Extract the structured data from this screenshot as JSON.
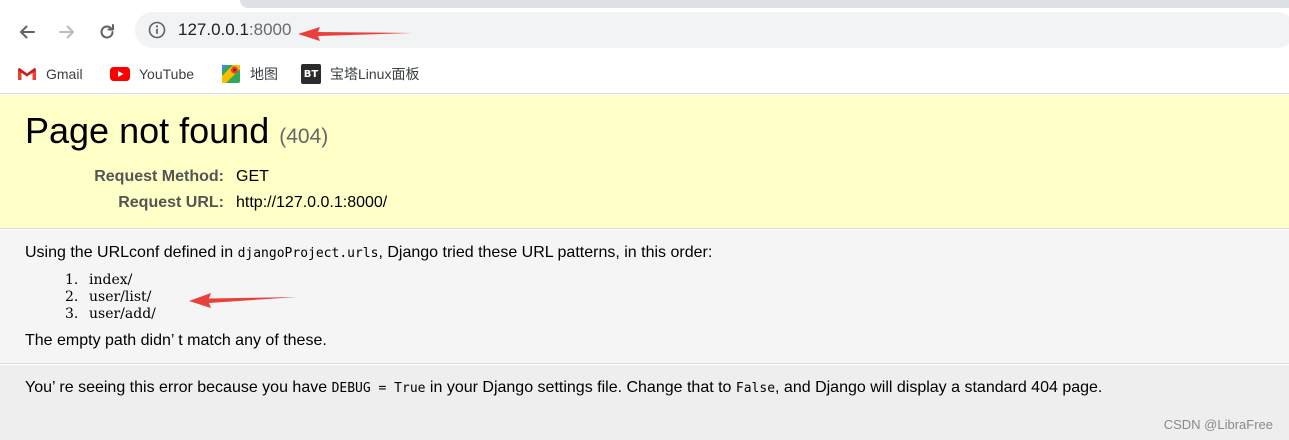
{
  "browser": {
    "address_bar": {
      "host": "127.0.0.1",
      "port": ":8000"
    },
    "bookmarks": [
      {
        "label": "Gmail",
        "icon": "gmail-icon"
      },
      {
        "label": "YouTube",
        "icon": "youtube-icon"
      },
      {
        "label": "地图",
        "icon": "maps-icon"
      },
      {
        "label": "宝塔Linux面板",
        "icon": "bt-icon",
        "icon_text": "BT"
      }
    ]
  },
  "error_page": {
    "title": "Page not found",
    "status": "(404)",
    "request_method_label": "Request Method:",
    "request_method": "GET",
    "request_url_label": "Request URL:",
    "request_url": "http://127.0.0.1:8000/",
    "intro_before": "Using the URLconf defined in ",
    "urlconf": "djangoProject.urls",
    "intro_after": ", Django tried these URL patterns, in this order:",
    "patterns": [
      {
        "num": "1.",
        "path": "index/"
      },
      {
        "num": "2.",
        "path": "user/list/"
      },
      {
        "num": "3.",
        "path": "user/add/"
      }
    ],
    "empty_path_msg": "The empty path didn’ t match any of these.",
    "explanation": {
      "part1": "You’ re seeing this error because you have ",
      "debug_code": "DEBUG = True",
      "part2": " in your Django settings file. Change that to ",
      "false_code": "False",
      "part3": ", and Django will display a standard 404 page."
    }
  },
  "watermark": "CSDN @LibraFree",
  "colors": {
    "summary_bg": "#ffffc8",
    "info_bg": "#f5f5f5",
    "explanation_bg": "#eeeeee",
    "annotation_arrow": "#e8403a"
  }
}
